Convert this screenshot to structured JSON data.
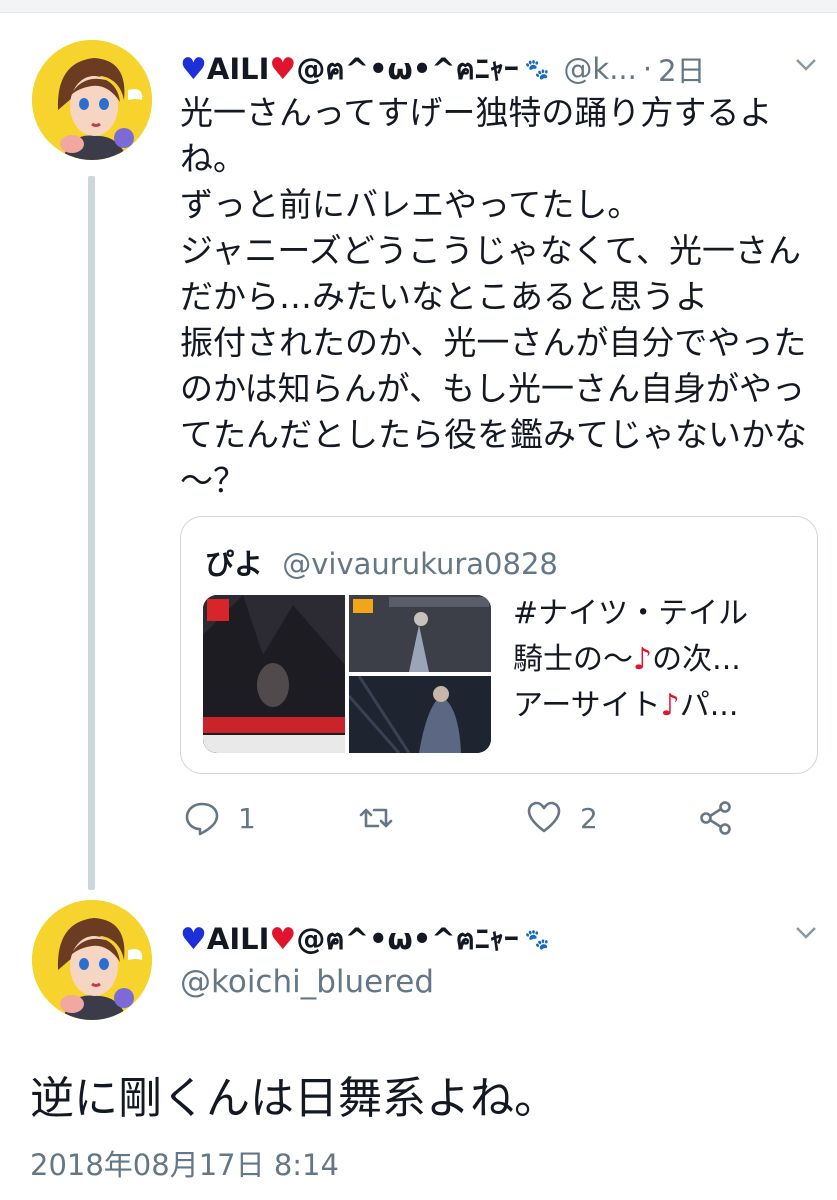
{
  "tweet1": {
    "heart_left": "♥",
    "display_name": "AILI",
    "heart_right": "♥",
    "name_suffix": "@ฅ^•ω•^ฅﾆｬｰ",
    "paw": "🐾",
    "handle": "@k...",
    "separator": "·",
    "time": "2日",
    "text": "光一さんってすげー独特の踊り方するよね。\nずっと前にバレエやってたし。\nジャニーズどうこうじゃなくて、光一さんだから…みたいなとこあると思うよ\n振付されたのか、光一さんが自分でやったのかは知らんが、もし光一さん自身がやってたんだとしたら役を鑑みてじゃないかな～？",
    "quote": {
      "name": "ぴよ",
      "handle": "@vivaurukura0828",
      "line1": "#ナイツ・テイル",
      "line2_a": "騎士の～",
      "line2_note": "♪",
      "line2_b": "の次...",
      "line3_a": "アーサイト",
      "line3_note": "♪",
      "line3_b": "パ..."
    },
    "reply_count": "1",
    "retweet_count": "",
    "like_count": "2"
  },
  "tweet2": {
    "heart_left": "♥",
    "display_name": "AILI",
    "heart_right": "♥",
    "name_suffix": "@ฅ^•ω•^ฅﾆｬｰ",
    "paw": "🐾",
    "handle": "@koichi_bluered",
    "text": "逆に剛くんは日舞系よね。",
    "timestamp": "2018年08月17日 8:14"
  },
  "colors": {
    "accent_blue": "#1d2fd8",
    "accent_red": "#e0142c",
    "secondary_text": "#657786",
    "avatar_bg": "#f6d42d"
  }
}
